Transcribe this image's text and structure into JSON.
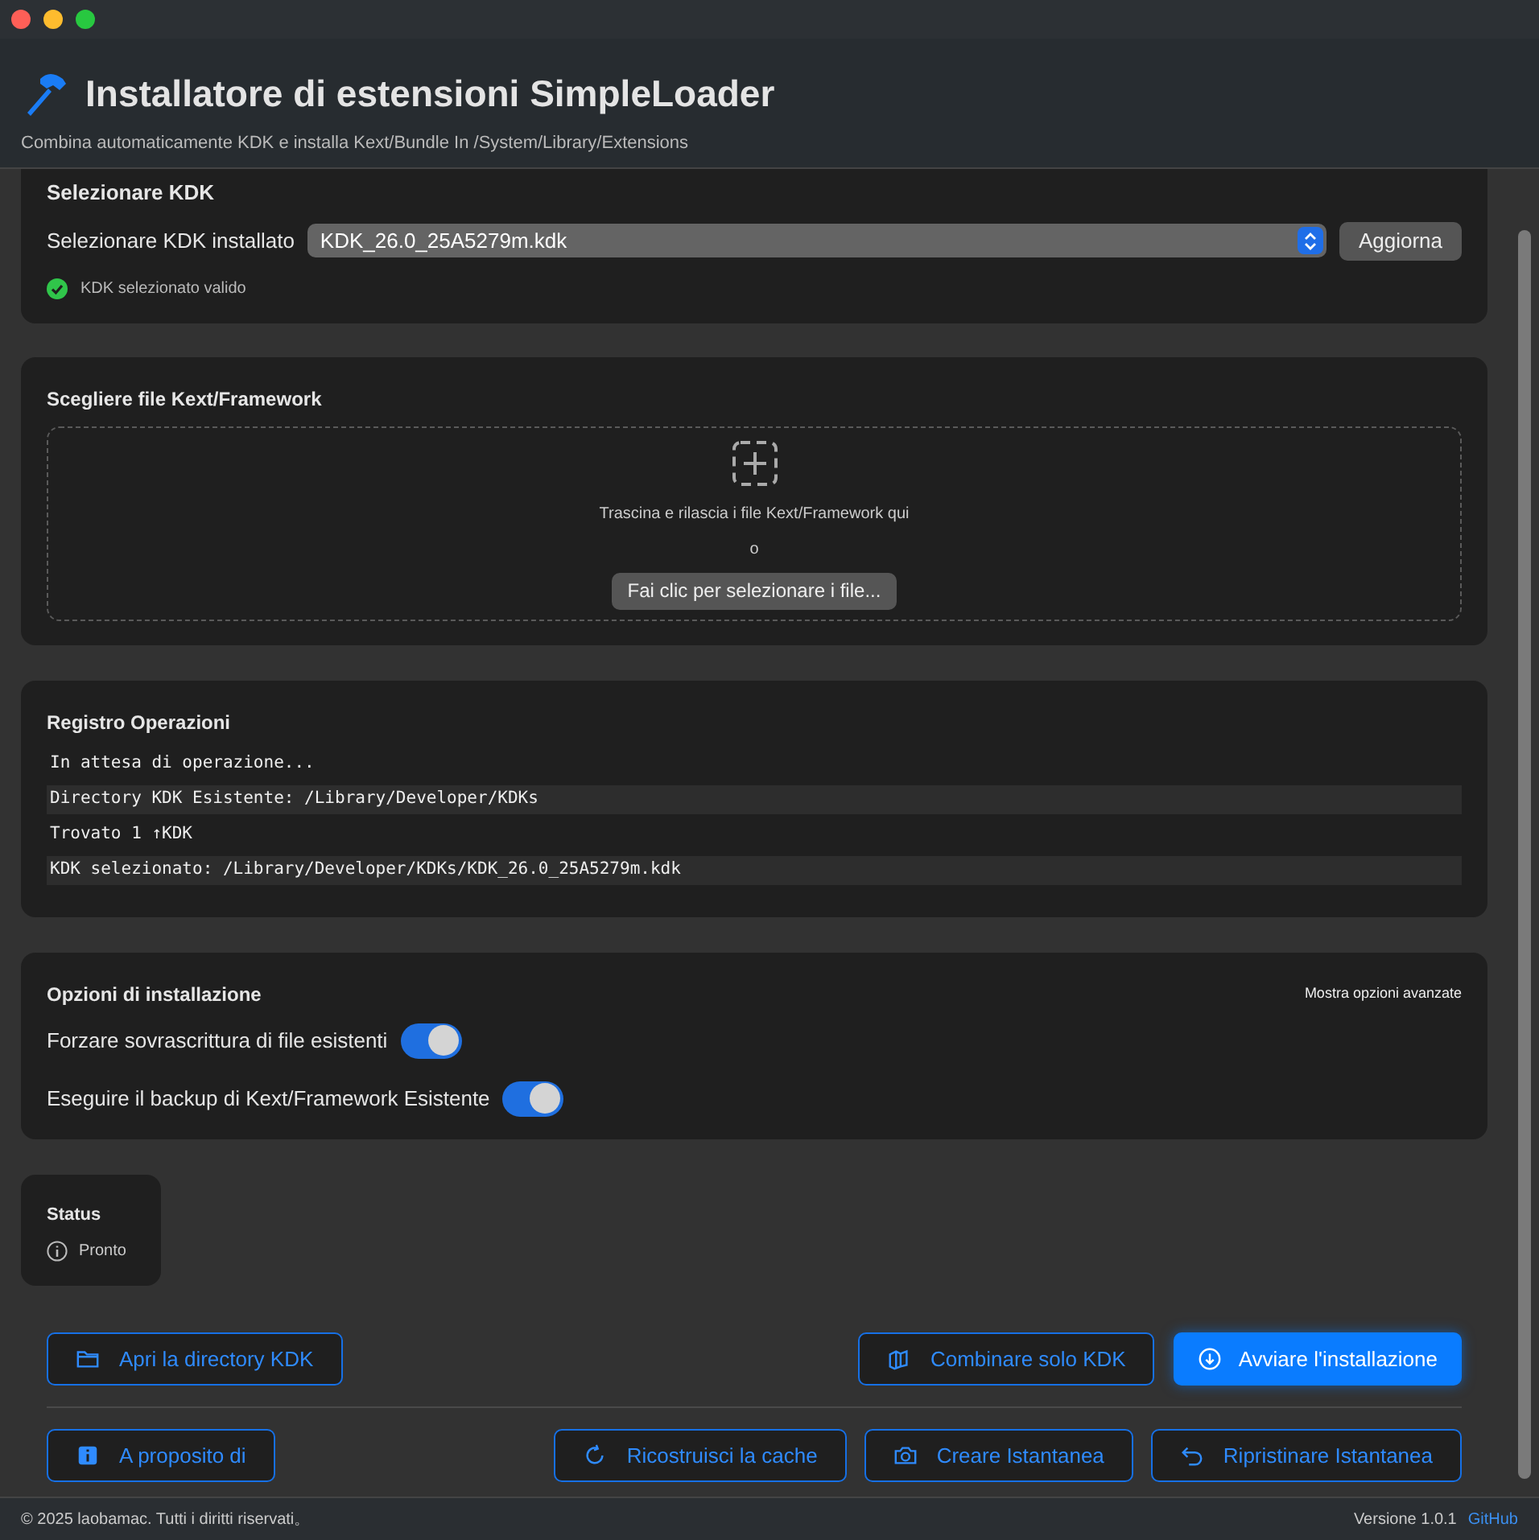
{
  "window": {
    "title": "Installatore di estensioni SimpleLoader",
    "subtitle": "Combina automaticamente KDK e installa Kext/Bundle In /System/Library/Extensions"
  },
  "kdk_section": {
    "title": "Selezionare KDK",
    "label": "Selezionare KDK installato",
    "value": "KDK_26.0_25A5279m.kdk",
    "refresh_button": "Aggiorna",
    "validation": "KDK selezionato valido",
    "valid": true
  },
  "files_section": {
    "title": "Scegliere file Kext/Framework",
    "drop_hint": "Trascina e rilascia i file Kext/Framework qui",
    "or": "o",
    "choose_button": "Fai clic per selezionare i file..."
  },
  "log_section": {
    "title": "Registro Operazioni",
    "lines": [
      "In attesa di operazione...",
      "Directory KDK Esistente: /Library/Developer/KDKs",
      "Trovato 1 ↑KDK",
      "KDK selezionato: /Library/Developer/KDKs/KDK_26.0_25A5279m.kdk"
    ]
  },
  "options_section": {
    "title": "Opzioni di installazione",
    "advanced_link": "Mostra opzioni avanzate",
    "options": [
      {
        "label": "Forzare sovrascrittura di file esistenti",
        "on": true
      },
      {
        "label": "Eseguire il backup di Kext/Framework Esistente",
        "on": true
      }
    ]
  },
  "status": {
    "title": "Status",
    "text": "Pronto"
  },
  "actions_row_1": [
    {
      "label": "Apri la directory KDK",
      "kind": "outline"
    },
    {
      "label": "Combinare solo KDK",
      "kind": "outline"
    },
    {
      "label": "Avviare l'installazione",
      "kind": "primary"
    }
  ],
  "actions_row_2": [
    {
      "label": "A proposito di",
      "kind": "outline"
    },
    {
      "label": "Ricostruisci la cache",
      "kind": "outline"
    },
    {
      "label": "Creare Istantanea",
      "kind": "outline"
    },
    {
      "label": "Ripristinare Istantanea",
      "kind": "outline"
    }
  ],
  "status_bar": {
    "copyright": "© 2025 laobamac. Tutti i diritti riservati。",
    "version": "Versione 1.0.1",
    "link": "GitHub"
  }
}
